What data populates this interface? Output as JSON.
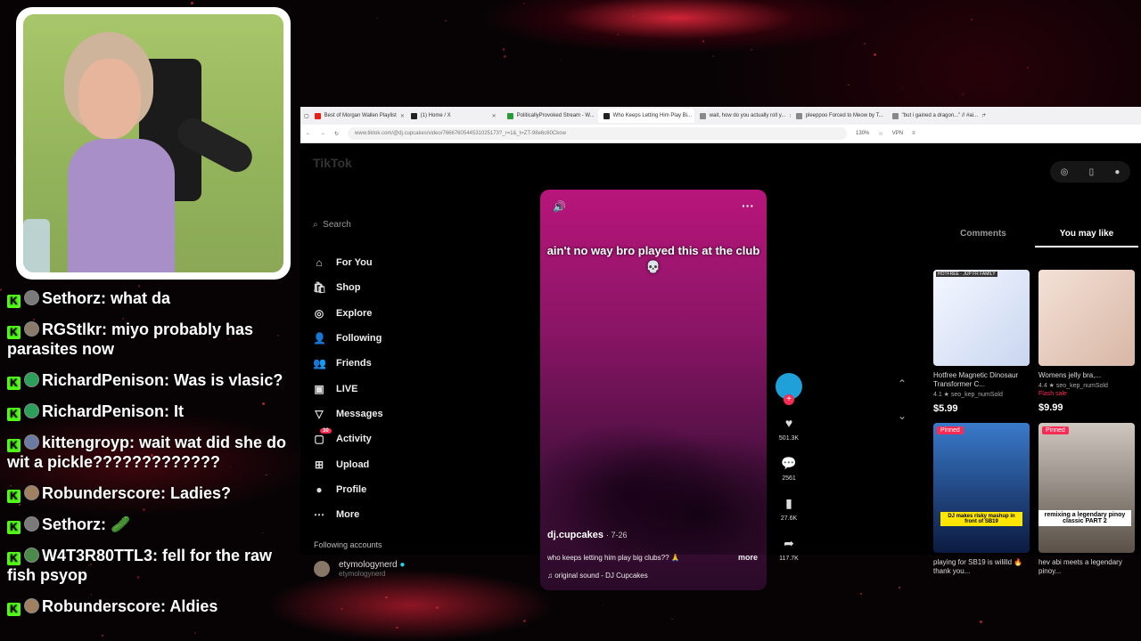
{
  "chat": [
    {
      "user": "Sethorz",
      "text": "what da",
      "color": "#7a7a7a"
    },
    {
      "user": "RGStlkr",
      "text": "miyo probably has parasites now",
      "color": "#8a7a6a"
    },
    {
      "user": "RichardPenison",
      "text": "Was is vlasic?",
      "color": "#2aa05a"
    },
    {
      "user": "RichardPenison",
      "text": "It",
      "color": "#2aa05a"
    },
    {
      "user": "kittengroyp",
      "text": "wait wat did she do wit a pickle?????????????",
      "color": "#6a7aa0"
    },
    {
      "user": "Robunderscore",
      "text": "Ladies?",
      "color": "#a08060"
    },
    {
      "user": "Sethorz",
      "text": "",
      "color": "#7a7a7a",
      "emote": "🥒"
    },
    {
      "user": "W4T3R80TTL3",
      "text": "fell for the raw fish psyop",
      "color": "#4a8a4a"
    },
    {
      "user": "Robunderscore",
      "text": "Aldies",
      "color": "#a08060"
    }
  ],
  "browser": {
    "tabs": [
      {
        "label": "Best of Morgan Wallen Playlist",
        "color": "#e62117"
      },
      {
        "label": "(1) Home / X",
        "color": "#222"
      },
      {
        "label": "PoliticallyProvoked Stream - W...",
        "color": "#2a9a3a"
      },
      {
        "label": "Who Keeps Letting Him Play Bi...",
        "color": "#222",
        "active": true
      },
      {
        "label": "wait, how do you actually roll y...",
        "color": "#888"
      },
      {
        "label": "pleeppoo Forced to Meow by T...",
        "color": "#888"
      },
      {
        "label": "\"but i gained a dragon...\" // #ai...",
        "color": "#888"
      }
    ],
    "url": "www.tiktok.com/@dj.cupcakes/video/7666760544531025173?_r=1&_t=ZT-98e6c60Ckow",
    "zoom": "130%",
    "vpn": "VPN"
  },
  "tiktok": {
    "logo": "TikTok",
    "search_placeholder": "Search",
    "nav": [
      {
        "icon": "house-icon",
        "glyph": "⌂",
        "label": "For You"
      },
      {
        "icon": "shop-icon",
        "glyph": "🛍",
        "label": "Shop"
      },
      {
        "icon": "compass-icon",
        "glyph": "◎",
        "label": "Explore"
      },
      {
        "icon": "following-icon",
        "glyph": "👤",
        "label": "Following"
      },
      {
        "icon": "friends-icon",
        "glyph": "👥",
        "label": "Friends"
      },
      {
        "icon": "live-icon",
        "glyph": "▣",
        "label": "LIVE"
      },
      {
        "icon": "messages-icon",
        "glyph": "▽",
        "label": "Messages"
      },
      {
        "icon": "activity-icon",
        "glyph": "▢",
        "label": "Activity",
        "badge": "30"
      },
      {
        "icon": "upload-icon",
        "glyph": "⊞",
        "label": "Upload"
      },
      {
        "icon": "profile-icon",
        "glyph": "●",
        "label": "Profile"
      },
      {
        "icon": "more-icon",
        "glyph": "⋯",
        "label": "More"
      }
    ],
    "following_title": "Following accounts",
    "account": {
      "name": "etymologynerd",
      "handle": "etymologynerd"
    },
    "video": {
      "caption": "ain't no way bro played this at the club 💀",
      "author": "dj.cupcakes",
      "date": "· 7-26",
      "description": "who keeps letting him play big clubs?? 🙏",
      "more": "more",
      "sound": "♫  original sound - DJ Cupcakes"
    },
    "actions": {
      "likes": "501.3K",
      "comments": "2561",
      "saves": "27.6K",
      "shares": "117.7K"
    },
    "right_tabs": [
      "Comments",
      "You may like"
    ],
    "cards": [
      {
        "title": "Hotfree Magnetic Dinosaur Transformer C...",
        "rating": "4.1 ★  seo_kep_numSold",
        "price": "$5.99",
        "badge": "HOTFREE · JUP FR FAMILY",
        "bg": "linear-gradient(135deg,#f4f7ff,#c9d6f0)"
      },
      {
        "title": "Womens jelly bra,...",
        "rating": "4.4 ★  seo_kep_numSold",
        "flash": "Flash sale",
        "price": "$9.99",
        "bg": "linear-gradient(135deg,#f3e1d6,#d8b7a6)"
      },
      {
        "title": "playing for SB19 is wililld 🔥 thank you...",
        "pinned": "Pinned",
        "overlay": "DJ makes risky mashup in front of SB19",
        "bg": "linear-gradient(180deg,#3a7acb,#0c1a40)"
      },
      {
        "title": "hev abi meets a legendary pinoy...",
        "pinned": "Pinned",
        "overlay": "remixing a legendary pinoy classic PART 2",
        "bg": "linear-gradient(180deg,#cfc8c0,#5a5048)"
      }
    ]
  }
}
